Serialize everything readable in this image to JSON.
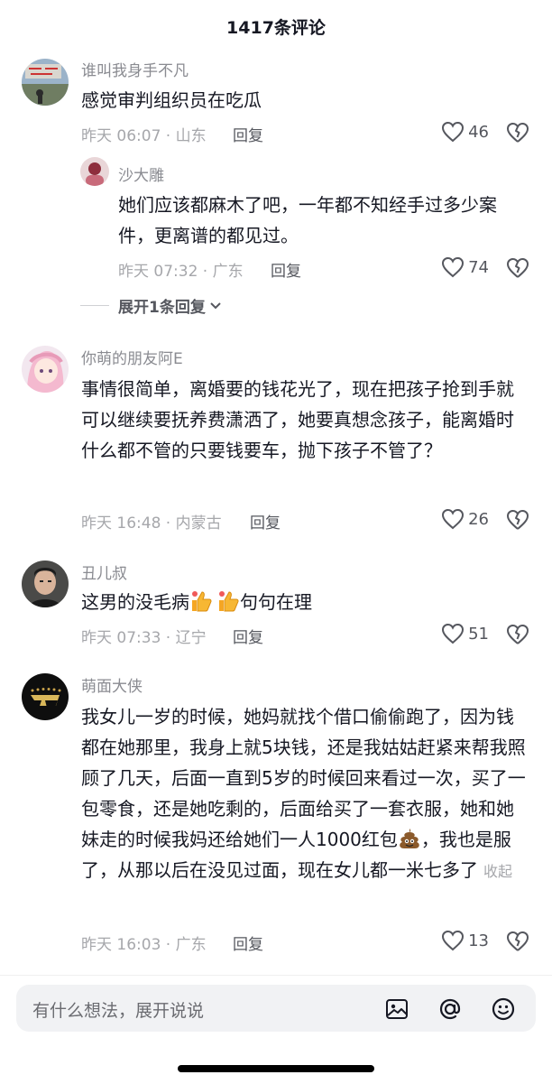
{
  "header": {
    "title": "1417条评论"
  },
  "comments": [
    {
      "username": "谁叫我身手不凡",
      "text": "感觉审判组织员在吃瓜",
      "meta": "昨天 06:07 · 山东",
      "reply_label": "回复",
      "likes": "46",
      "replies": [
        {
          "username": "沙大雕",
          "text": "她们应该都麻木了吧，一年都不知经手过多少案件，更离谱的都见过。",
          "meta": "昨天 07:32 · 广东",
          "reply_label": "回复",
          "likes": "74"
        }
      ],
      "expand_label": "展开1条回复"
    },
    {
      "username": "你萌的朋友阿E",
      "text": "事情很简单，离婚要的钱花光了，现在把孩子抢到手就可以继续要抚养费潇洒了，她要真想念孩子，能离婚时什么都不管的只要钱要车，抛下孩子不管了？",
      "meta": "昨天 16:48 · 内蒙古",
      "reply_label": "回复",
      "likes": "26"
    },
    {
      "username": "丑儿叔",
      "text_before": "这男的没毛病",
      "text_after": "句句在理",
      "emoji": "thumbs-up",
      "meta": "昨天 07:33 · 辽宁",
      "reply_label": "回复",
      "likes": "51"
    },
    {
      "username": "萌面大侠",
      "text_before": "我女儿一岁的时候，她妈就找个借口偷偷跑了，因为钱都在她那里，我身上就5块钱，还是我姑姑赶紧来帮我照顾了几天，后面一直到5岁的时候回来看过一次，买了一包零食，还是她吃剩的，后面给买了一套衣服，她和她妹走的时候我妈还给她们一人1000红包",
      "text_after": "，我也是服了，从那以后在没见过面，现在女儿都一米七多了",
      "emoji": "poop",
      "collapse_label": "收起",
      "meta": "昨天 16:03 · 广东",
      "reply_label": "回复",
      "likes": "13"
    }
  ],
  "input": {
    "placeholder": "有什么想法，展开说说"
  },
  "icons": {
    "heart": "heart-outline-icon",
    "dislike": "broken-heart-icon",
    "image": "image-icon",
    "mention": "at-sign-icon",
    "emoji": "smiley-icon",
    "chevron": "chevron-down-icon"
  }
}
